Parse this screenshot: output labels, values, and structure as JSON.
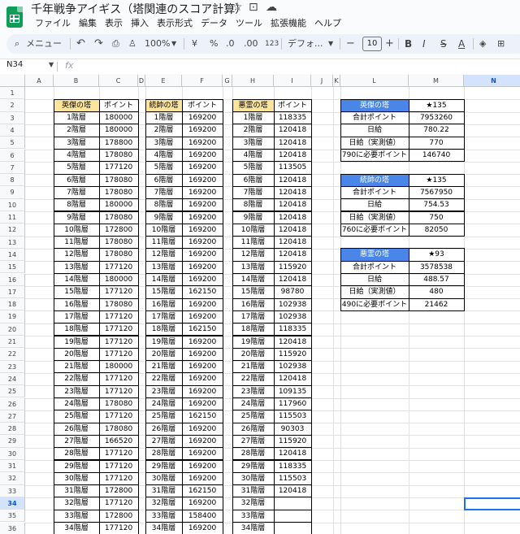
{
  "app": {
    "title": "千年戦争アイギス（塔関連のスコア計算）",
    "icons": [
      "star-icon",
      "move-to-folder-icon",
      "cloud-status-icon"
    ]
  },
  "menu": [
    "ファイル",
    "編集",
    "表示",
    "挿入",
    "表示形式",
    "データ",
    "ツール",
    "拡張機能",
    "ヘルプ"
  ],
  "toolbar": {
    "menu_search": "メニュー",
    "zoom": "100%",
    "currency": "¥",
    "percent": "%",
    "decimal_decrease": ".0",
    "decimal_increase": ".00",
    "number_format": "123",
    "font": "デフォ...",
    "font_size": "10"
  },
  "formula_bar": {
    "name_box": "N34",
    "fx": "fx",
    "content": ""
  },
  "columns": [
    "A",
    "B",
    "C",
    "D",
    "E",
    "F",
    "G",
    "H",
    "I",
    "J",
    "K",
    "L",
    "M",
    "N"
  ],
  "selected_column": "N",
  "selected_row": 34,
  "rows_visible": [
    1,
    2,
    3,
    4,
    5,
    6,
    7,
    8,
    9,
    10,
    11,
    12,
    13,
    14,
    15,
    16,
    17,
    18,
    19,
    20,
    21,
    22,
    23,
    24,
    25,
    26,
    27,
    28,
    29,
    30,
    31,
    32,
    33,
    34,
    35,
    36
  ],
  "tables": {
    "hero": {
      "headers": [
        "英傑の塔",
        "ポイント"
      ],
      "floors": [
        "1階層",
        "2階層",
        "3階層",
        "4階層",
        "5階層",
        "6階層",
        "7階層",
        "8階層",
        "9階層",
        "10階層",
        "11階層",
        "12階層",
        "13階層",
        "14階層",
        "15階層",
        "16階層",
        "17階層",
        "18階層",
        "19階層",
        "20階層",
        "21階層",
        "22階層",
        "23階層",
        "24階層",
        "25階層",
        "26階層",
        "27階層",
        "28階層",
        "29階層",
        "30階層",
        "31階層",
        "32階層",
        "33階層",
        "34階層"
      ],
      "points": [
        "180000",
        "180000",
        "178800",
        "178080",
        "177120",
        "178080",
        "178080",
        "180000",
        "178080",
        "172800",
        "178080",
        "178080",
        "177120",
        "180000",
        "177120",
        "178080",
        "177120",
        "177120",
        "177120",
        "177120",
        "180000",
        "177120",
        "177120",
        "178080",
        "177120",
        "178080",
        "166520",
        "177120",
        "177120",
        "177120",
        "172800",
        "177120",
        "172800",
        "177120"
      ]
    },
    "commander": {
      "headers": [
        "統帥の塔",
        "ポイント"
      ],
      "floors": [
        "1階層",
        "2階層",
        "3階層",
        "4階層",
        "5階層",
        "6階層",
        "7階層",
        "8階層",
        "9階層",
        "10階層",
        "11階層",
        "12階層",
        "13階層",
        "14階層",
        "15階層",
        "16階層",
        "17階層",
        "18階層",
        "19階層",
        "20階層",
        "21階層",
        "22階層",
        "23階層",
        "24階層",
        "25階層",
        "26階層",
        "27階層",
        "28階層",
        "29階層",
        "30階層",
        "31階層",
        "32階層",
        "33階層",
        "34階層"
      ],
      "points": [
        "169200",
        "169200",
        "169200",
        "169200",
        "169200",
        "169200",
        "169200",
        "169200",
        "169200",
        "169200",
        "169200",
        "169200",
        "169200",
        "169200",
        "162150",
        "169200",
        "169200",
        "162150",
        "169200",
        "169200",
        "169200",
        "169200",
        "169200",
        "169200",
        "162150",
        "169200",
        "169200",
        "169200",
        "169200",
        "169200",
        "162150",
        "169200",
        "158400",
        "169200"
      ]
    },
    "evil": {
      "headers": [
        "悪霊の塔",
        "ポイント"
      ],
      "floors": [
        "1階層",
        "2階層",
        "3階層",
        "4階層",
        "5階層",
        "6階層",
        "7階層",
        "8階層",
        "9階層",
        "10階層",
        "11階層",
        "12階層",
        "13階層",
        "14階層",
        "15階層",
        "16階層",
        "17階層",
        "18階層",
        "19階層",
        "20階層",
        "21階層",
        "22階層",
        "23階層",
        "24階層",
        "25階層",
        "26階層",
        "27階層",
        "28階層",
        "29階層",
        "30階層",
        "31階層",
        "32階層",
        "33階層",
        "34階層"
      ],
      "points": [
        "118335",
        "120418",
        "120418",
        "120418",
        "113505",
        "120418",
        "120418",
        "120418",
        "120418",
        "120418",
        "120418",
        "120418",
        "115920",
        "120418",
        "98780",
        "102938",
        "102938",
        "118335",
        "120418",
        "115920",
        "102938",
        "120418",
        "109135",
        "117960",
        "115503",
        "90303",
        "115920",
        "120418",
        "118335",
        "115503",
        "120418",
        "",
        "",
        ""
      ]
    }
  },
  "summaries": [
    {
      "title": "英傑の塔",
      "stars": "★135",
      "labels": [
        "合計ポイント",
        "日給",
        "日給（実測値）",
        "790に必要ポイント"
      ],
      "values": [
        "7953260",
        "780.22",
        "770",
        "146740"
      ]
    },
    {
      "title": "統帥の塔",
      "stars": "★135",
      "labels": [
        "合計ポイント",
        "日給",
        "日給（実測値）",
        "760に必要ポイント"
      ],
      "values": [
        "7567950",
        "754.53",
        "750",
        "82050"
      ]
    },
    {
      "title": "悪霊の塔",
      "stars": "★93",
      "labels": [
        "合計ポイント",
        "日給",
        "日給（実測値）",
        "490に必要ポイント"
      ],
      "values": [
        "3578538",
        "488.57",
        "480",
        "21462"
      ]
    }
  ]
}
